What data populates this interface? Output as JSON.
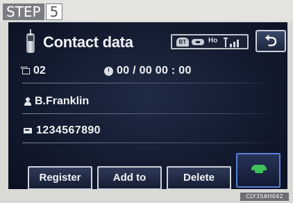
{
  "header": {
    "step_label": "STEP",
    "step_number": "5"
  },
  "screen": {
    "title": "Contact data",
    "status": {
      "ho_text": "Ho",
      "icons": [
        "bluetooth-icon",
        "link-icon",
        "signal-icon"
      ]
    },
    "back_label": "⮌",
    "rows": {
      "count": "02",
      "datetime": "00 / 00  00 : 00",
      "name": "B.Franklin",
      "number": "1234567890"
    },
    "buttons": {
      "register": "Register",
      "add_to": "Add to",
      "delete": "Delete"
    },
    "colors": {
      "background": "#121a2e",
      "call": "#3fc25a",
      "call_border": "#5a7fd6"
    }
  },
  "footer": {
    "code": "CLY35AH042"
  }
}
